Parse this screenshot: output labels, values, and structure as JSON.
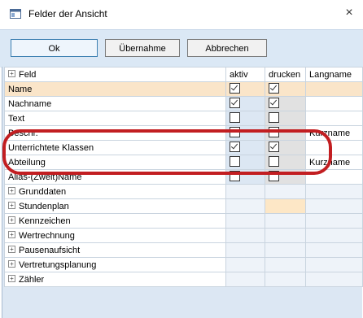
{
  "window": {
    "title": "Felder der Ansicht",
    "close_glyph": "×",
    "icon": "window-icon"
  },
  "toolbar": {
    "ok_label": "Ok",
    "uebernahme_label": "Übernahme",
    "abbrechen_label": "Abbrechen"
  },
  "grid": {
    "headers": {
      "feld": "Feld",
      "aktiv": "aktiv",
      "drucken": "drucken",
      "langname": "Langname"
    },
    "rows": [
      {
        "label": "Name",
        "bold": true,
        "aktiv": true,
        "drucken": true,
        "langname": "",
        "highlight": true
      },
      {
        "label": "Nachname",
        "bold": true,
        "aktiv": true,
        "drucken": true,
        "langname": ""
      },
      {
        "label": "Text",
        "bold": false,
        "aktiv": false,
        "drucken": false,
        "langname": ""
      },
      {
        "label": "Beschr.",
        "bold": false,
        "aktiv": false,
        "drucken": false,
        "langname": "Kurzname"
      },
      {
        "label": "Unterrichtete Klassen",
        "bold": true,
        "aktiv": true,
        "drucken": true,
        "langname": ""
      },
      {
        "label": "Abteilung",
        "bold": false,
        "aktiv": false,
        "drucken": false,
        "langname": "Kurzname"
      },
      {
        "label": "Alias-(Zweit)Name",
        "bold": false,
        "aktiv": false,
        "drucken": false,
        "langname": ""
      }
    ],
    "groups": [
      "Grunddaten",
      "Stundenplan",
      "Kennzeichen",
      "Wertrechnung",
      "Pausenaufsicht",
      "Vertretungsplanung",
      "Zähler"
    ]
  },
  "colors": {
    "accent_highlight": "#fae5c9",
    "toolbar_bg": "#dbe8f5",
    "annotation_red": "#c21e21"
  }
}
